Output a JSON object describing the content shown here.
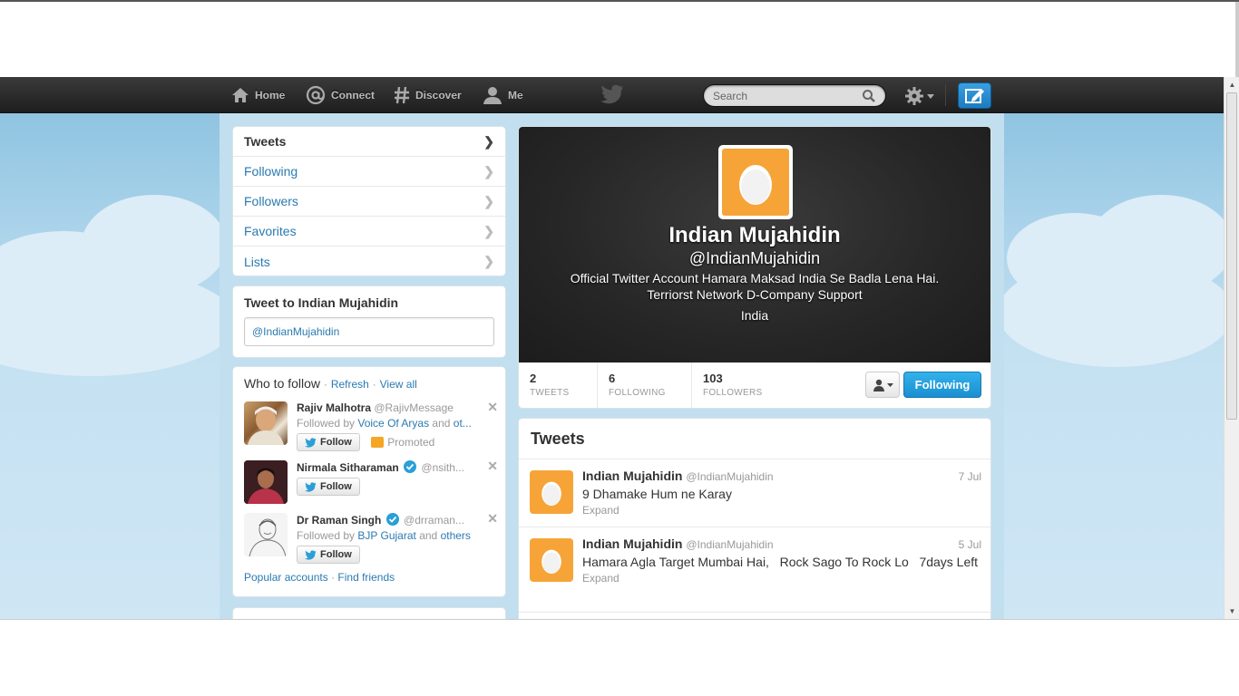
{
  "nav": {
    "home": "Home",
    "connect": "Connect",
    "discover": "Discover",
    "me": "Me",
    "search_placeholder": "Search"
  },
  "sidebar": {
    "items": [
      {
        "label": "Tweets"
      },
      {
        "label": "Following"
      },
      {
        "label": "Followers"
      },
      {
        "label": "Favorites"
      },
      {
        "label": "Lists"
      }
    ]
  },
  "tweet_to": {
    "title": "Tweet to Indian Mujahidin",
    "value": "@IndianMujahidin"
  },
  "who_to_follow": {
    "title": "Who to follow",
    "refresh": "Refresh",
    "view_all": "View all",
    "follow_label": "Follow",
    "promoted": "Promoted",
    "suggestions": [
      {
        "name": "Rajiv Malhotra",
        "handle": "@RajivMessage",
        "followed_prefix": "Followed by",
        "followed_link": "Voice Of Aryas",
        "followed_and": "and",
        "followed_others": "ot..."
      },
      {
        "name": "Nirmala Sitharaman",
        "handle": "@nsith..."
      },
      {
        "name": "Dr Raman Singh",
        "handle": "@drraman...",
        "followed_prefix": "Followed by",
        "followed_link": "BJP Gujarat",
        "followed_and": "and",
        "followed_others": "others"
      }
    ],
    "popular": "Popular accounts",
    "find_friends": "Find friends"
  },
  "profile": {
    "name": "Indian Mujahidin",
    "handle": "@IndianMujahidin",
    "bio": "Official Twitter Account   Hamara Maksad India Se Badla Lena Hai. Terriorst Network D-Company Support",
    "location": "India",
    "stats": [
      {
        "num": "2",
        "label": "TWEETS"
      },
      {
        "num": "6",
        "label": "FOLLOWING"
      },
      {
        "num": "103",
        "label": "FOLLOWERS"
      }
    ],
    "following_label": "Following"
  },
  "tweets": {
    "title": "Tweets",
    "items": [
      {
        "name": "Indian Mujahidin",
        "handle": "@IndianMujahidin",
        "time": "7 Jul",
        "text": "9 Dhamake Hum ne Karay",
        "expand": "Expand"
      },
      {
        "name": "Indian Mujahidin",
        "handle": "@IndianMujahidin",
        "time": "5 Jul",
        "text": "Hamara Agla Target Mumbai Hai,   Rock Sago To Rock Lo   7days Left",
        "expand": "Expand"
      }
    ]
  },
  "colors": {
    "link": "#2a7ab0",
    "accent": "#1a8fd0",
    "egg": "#f6a438",
    "topbar": "#2a2a2a"
  }
}
